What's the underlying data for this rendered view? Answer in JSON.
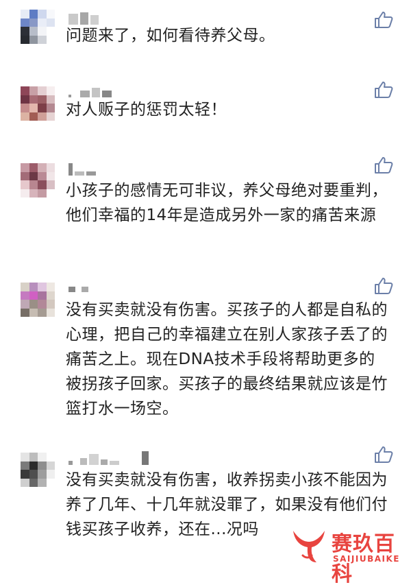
{
  "comments": [
    {
      "text": "问题来了，如何看待养父母。",
      "liked": false
    },
    {
      "text": "对人贩子的惩罚太轻！",
      "liked": false
    },
    {
      "text": "小孩子的感情无可非议，养父母绝对要重判，他们幸福的14年是造成另外一家的痛苦来源",
      "liked": false
    },
    {
      "text": "没有买卖就没有伤害。买孩子的人都是自私的心理，把自己的幸福建立在别人家孩子丢了的痛苦之上。现在DNA技术手段将帮助更多的被拐孩子回家。买孩子的最终结果就应该是竹篮打水一场空。",
      "liked": false
    },
    {
      "text": "没有买卖就没有伤害，收养拐卖小孩不能因为养了几年、十几年就没罪了，如果没有他们付钱买孩子收养，还在...况吗",
      "liked": false
    }
  ],
  "icons": {
    "like": "thumbs-up-icon",
    "avatar": "pixelated-avatar",
    "logo": "whale-tail-logo"
  },
  "watermark": {
    "title": "赛玖百科",
    "subtitle": "SAIJIUBAIKE"
  },
  "colors": {
    "watermark": "#e8443f",
    "like_icon": "#6b7fa8",
    "text": "#222222"
  }
}
